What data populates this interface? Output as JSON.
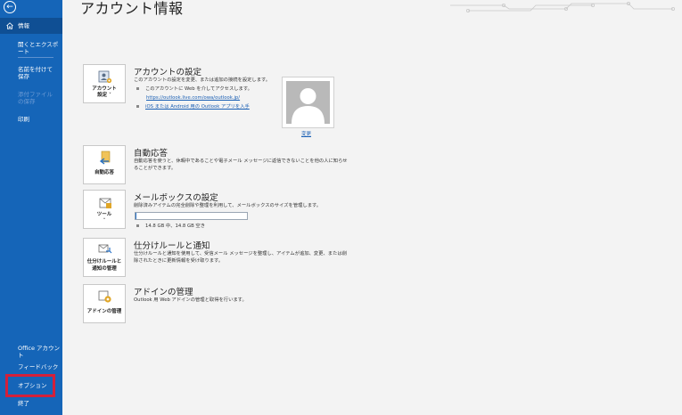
{
  "sidebar": {
    "back_icon": "back-arrow-icon",
    "items": [
      {
        "label": "情報",
        "active": true
      },
      {
        "label": "開くとエクスポート"
      },
      {
        "label": "名前を付けて保存"
      },
      {
        "label": "添付ファイルの保存",
        "disabled": true
      },
      {
        "label": "印刷"
      },
      {
        "label": "Office アカウント"
      },
      {
        "label": "フィードバック"
      },
      {
        "label": "オプション"
      },
      {
        "label": "終了"
      }
    ]
  },
  "page": {
    "title": "アカウント情報"
  },
  "account_settings": {
    "tile_label_1": "アカウント",
    "tile_label_2": "設定 ˅",
    "title": "アカウントの設定",
    "desc": "このアカウントの設定を変更、または追加の接続を設定します。",
    "bullet1": "このアカウントに Web を介してアクセスします。",
    "link1": "https://outlook.live.com/owa/outlook.jp/",
    "bullet2": "iOS または Android 用の Outlook アプリを入手"
  },
  "profile": {
    "change_label": "変更"
  },
  "auto_reply": {
    "tile_label": "自動応答",
    "title": "自動応答",
    "desc": "自動応答を使うと、休暇中であることや電子メール メッセージに返信できないことを他の人に知らせることができます。"
  },
  "mailbox": {
    "tile_label": "ツール",
    "tile_caret": "˅",
    "title": "メールボックスの設定",
    "desc": "削除済みアイテムの完全削除や整理を利用して、メールボックスのサイズを管理します。",
    "storage_text": "14.8 GB 中、14.8 GB 空き",
    "usage_fraction": 0.01
  },
  "rules": {
    "tile_label_1": "仕分けルールと",
    "tile_label_2": "通知の管理",
    "title": "仕分けルールと通知",
    "desc": "仕分けルールと通知を使用して、受信メール メッセージを整理し、アイテムが追加、変更、または削除されたときに更新情報を受け取ります。"
  },
  "addins": {
    "tile_label": "アドインの管理",
    "title": "アドインの管理",
    "desc": "Outlook 用 Web アドインの管理と取得を行います。"
  },
  "colors": {
    "sidebar": "#1565b8",
    "highlight": "#d3203a",
    "link": "#1a5fb4"
  }
}
